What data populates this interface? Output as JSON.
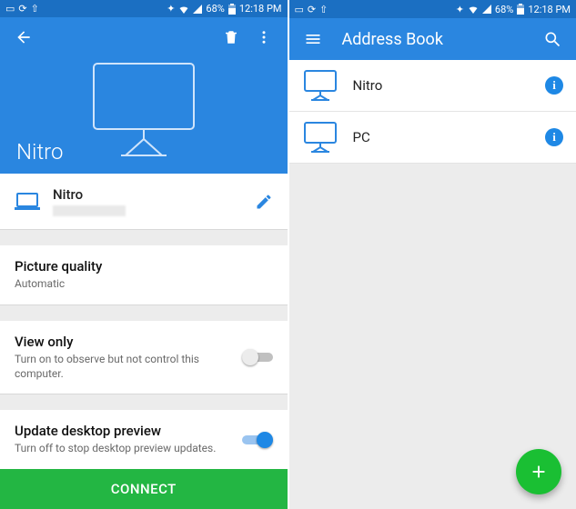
{
  "status_bar": {
    "battery_pct": "68%",
    "time": "12:18 PM"
  },
  "left": {
    "hero_title": "Nitro",
    "device": {
      "name": "Nitro"
    },
    "picture_quality": {
      "title": "Picture quality",
      "value": "Automatic"
    },
    "view_only": {
      "title": "View only",
      "sub": "Turn on to observe but not control this computer.",
      "on": false
    },
    "update_preview": {
      "title": "Update desktop preview",
      "sub": "Turn off to stop desktop preview updates.",
      "on": true
    },
    "connect_label": "CONNECT"
  },
  "right": {
    "title": "Address Book",
    "items": [
      {
        "label": "Nitro"
      },
      {
        "label": "PC"
      }
    ]
  }
}
